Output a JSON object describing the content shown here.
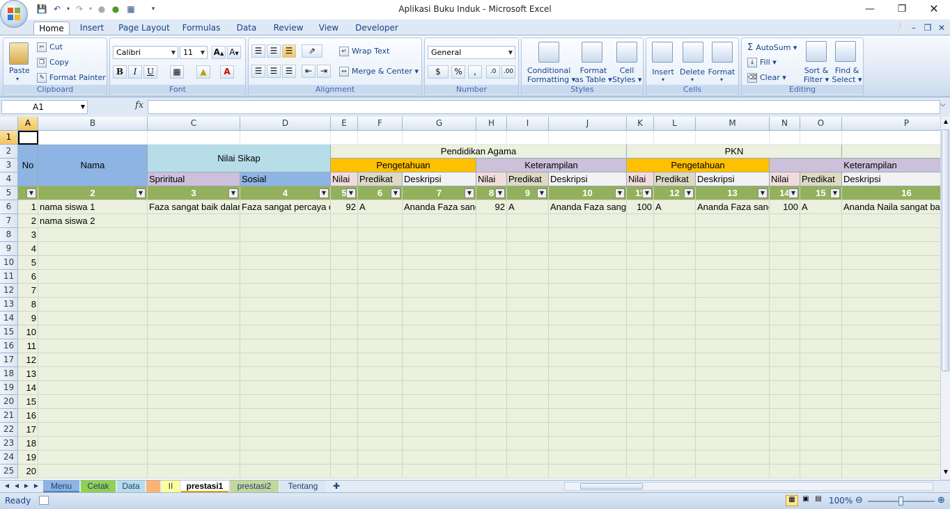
{
  "window": {
    "title": "Aplikasi Buku Induk - Microsoft Excel"
  },
  "tabs": [
    "Home",
    "Insert",
    "Page Layout",
    "Formulas",
    "Data",
    "Review",
    "View",
    "Developer"
  ],
  "clipboard": {
    "paste": "Paste",
    "cut": "Cut",
    "copy": "Copy",
    "format_painter": "Format Painter",
    "label": "Clipboard"
  },
  "font": {
    "name": "Calibri",
    "size": "11",
    "label": "Font"
  },
  "alignment": {
    "wrap_text": "Wrap Text",
    "merge_center": "Merge & Center",
    "label": "Alignment"
  },
  "number": {
    "format": "General",
    "label": "Number"
  },
  "styles": {
    "conditional_1": "Conditional",
    "conditional_2": "Formatting",
    "format_table_1": "Format",
    "format_table_2": "as Table",
    "cell_styles_1": "Cell",
    "cell_styles_2": "Styles",
    "label": "Styles"
  },
  "cells": {
    "insert": "Insert",
    "delete": "Delete",
    "format": "Format",
    "label": "Cells"
  },
  "editing": {
    "autosum": "AutoSum",
    "fill": "Fill",
    "clear": "Clear",
    "sort_1": "Sort &",
    "sort_2": "Filter",
    "find_1": "Find &",
    "find_2": "Select",
    "label": "Editing"
  },
  "formula_bar": {
    "name_box": "A1",
    "fx": "fx",
    "value": ""
  },
  "columns": [
    "A",
    "B",
    "C",
    "D",
    "E",
    "F",
    "G",
    "H",
    "I",
    "J",
    "K",
    "L",
    "M",
    "N",
    "O",
    "P"
  ],
  "rows": [
    "1",
    "2",
    "3",
    "4",
    "5",
    "6",
    "7",
    "8",
    "9",
    "10",
    "11",
    "12",
    "13",
    "14",
    "15",
    "16",
    "17",
    "18",
    "19",
    "20",
    "21",
    "22",
    "23",
    "24",
    "25"
  ],
  "sheet": {
    "no": "No",
    "nama": "Nama",
    "nilai_sikap": "Nilai Sikap",
    "spiritual": "Spriritual",
    "sosial": "Sosial",
    "pend_agama": "Pendidikan Agama",
    "pkn": "PKN",
    "pengetahuan": "Pengetahuan",
    "keterampilan": "Keterampilan",
    "nilai": "Nilai",
    "predikat": "Predikat",
    "deskripsi": "Deskripsi",
    "colnums": [
      "2",
      "3",
      "4",
      "5",
      "6",
      "7",
      "8",
      "9",
      "10",
      "11",
      "12",
      "13",
      "14",
      "15",
      "16"
    ],
    "row6": {
      "no": "1",
      "nama": "nama siswa 1",
      "spiritual": "Faza sangat baik dalam",
      "sosial": "Faza sangat percaya diri",
      "e": "92",
      "f": "A",
      "g": "Ananda Faza sangat",
      "h": "92",
      "i": "A",
      "j": "Ananda Faza sangat",
      "k": "100",
      "l": "A",
      "m": "Ananda Faza sangat",
      "n": "100",
      "o": "A",
      "p": "Ananda Naila sangat baik"
    },
    "row7": {
      "no": "2",
      "nama": "nama siswa 2"
    },
    "numbers": [
      "3",
      "4",
      "5",
      "6",
      "7",
      "8",
      "9",
      "10",
      "11",
      "12",
      "13",
      "14",
      "15",
      "16",
      "17",
      "18",
      "19",
      "20"
    ]
  },
  "sheet_tabs": [
    "Menu",
    "Cetak",
    "Data",
    "II",
    "prestasi1",
    "prestasi2",
    "Tentang"
  ],
  "status": {
    "ready": "Ready",
    "zoom": "100%"
  },
  "colors": {
    "accent": "#15428b",
    "header_green": "#93b05c",
    "cell_green": "#ebf1de",
    "orange": "#ffc000",
    "lavender": "#ccc0da",
    "blue_header": "#8db4e2",
    "light_blue": "#b7dee8"
  }
}
